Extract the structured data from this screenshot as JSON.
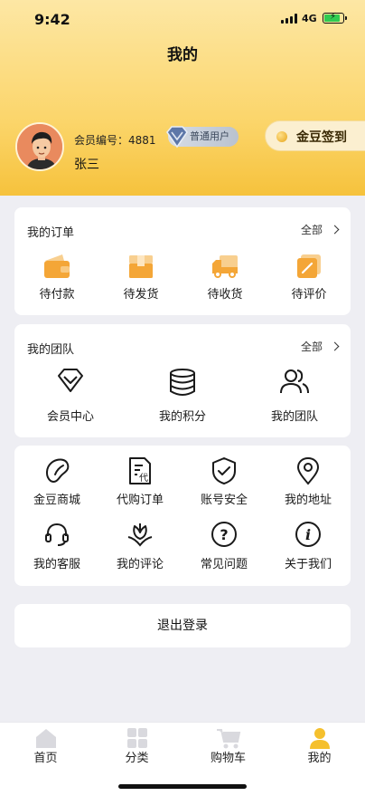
{
  "status_bar": {
    "time": "9:42",
    "network": "4G"
  },
  "header": {
    "title": "我的"
  },
  "profile": {
    "member_no": "会员编号：4881",
    "level_badge": "普通用户",
    "name": "张三",
    "checkin_label": "金豆签到"
  },
  "orders": {
    "title": "我的订单",
    "more": "全部",
    "items": [
      {
        "label": "待付款",
        "icon": "wallet-icon"
      },
      {
        "label": "待发货",
        "icon": "box-icon"
      },
      {
        "label": "待收货",
        "icon": "truck-icon"
      },
      {
        "label": "待评价",
        "icon": "edit-icon"
      }
    ]
  },
  "team": {
    "title": "我的团队",
    "more": "全部",
    "items": [
      {
        "label": "会员中心",
        "icon": "diamond-icon"
      },
      {
        "label": "我的积分",
        "icon": "coins-stack-icon"
      },
      {
        "label": "我的团队",
        "icon": "people-icon"
      }
    ]
  },
  "services": {
    "items": [
      {
        "label": "金豆商城",
        "icon": "bean-icon"
      },
      {
        "label": "代购订单",
        "icon": "document-icon",
        "icon_text": "代"
      },
      {
        "label": "账号安全",
        "icon": "shield-check-icon"
      },
      {
        "label": "我的地址",
        "icon": "location-pin-icon"
      },
      {
        "label": "我的客服",
        "icon": "headset-icon"
      },
      {
        "label": "我的评论",
        "icon": "flower-icon"
      },
      {
        "label": "常见问题",
        "icon": "question-icon",
        "icon_text": "?"
      },
      {
        "label": "关于我们",
        "icon": "info-icon",
        "icon_text": "i"
      }
    ]
  },
  "logout_label": "退出登录",
  "tabbar": {
    "items": [
      {
        "label": "首页",
        "icon": "home-icon",
        "active": false
      },
      {
        "label": "分类",
        "icon": "grid-icon",
        "active": false
      },
      {
        "label": "购物车",
        "icon": "cart-icon",
        "active": false
      },
      {
        "label": "我的",
        "icon": "user-icon",
        "active": true
      }
    ]
  },
  "colors": {
    "header_gold": "#f6c23c",
    "order_icon_orange": "#f4a637",
    "active_tab": "#f5c02d",
    "inactive_tab_icon": "#d9d9de"
  }
}
